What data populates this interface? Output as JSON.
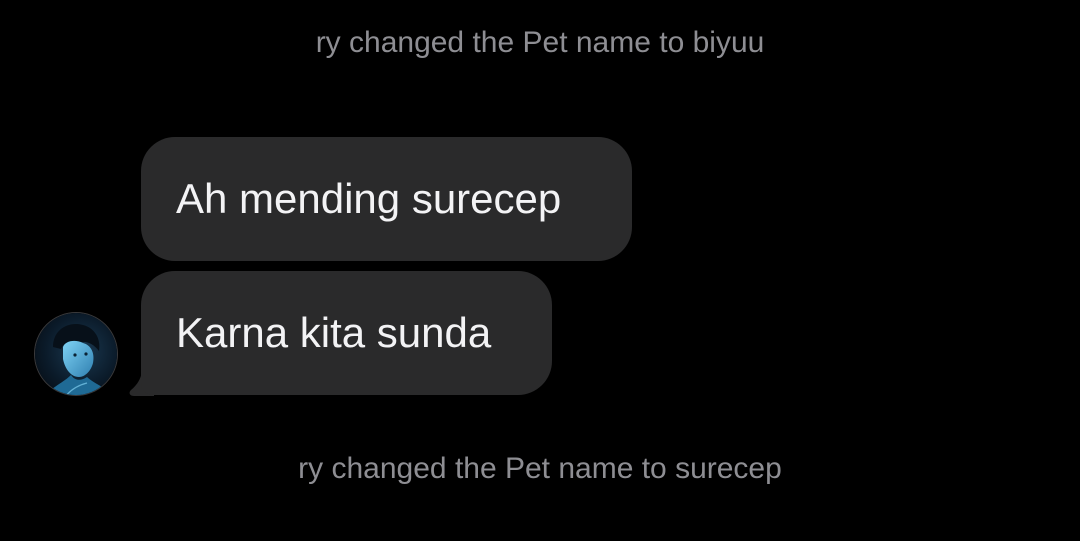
{
  "system_messages": {
    "top": "ry changed the Pet name to biyuu",
    "bottom": "ry changed the Pet name to surecep"
  },
  "messages": [
    {
      "text": "Ah mending surecep"
    },
    {
      "text": "Karna kita sunda"
    }
  ],
  "avatar": {
    "icon": "user-avatar",
    "accent": "#4fb6e8"
  },
  "colors": {
    "background": "#000000",
    "bubble": "#2a2a2b",
    "bubble_text": "#f3f3f5",
    "system_text": "#8e8e93"
  }
}
